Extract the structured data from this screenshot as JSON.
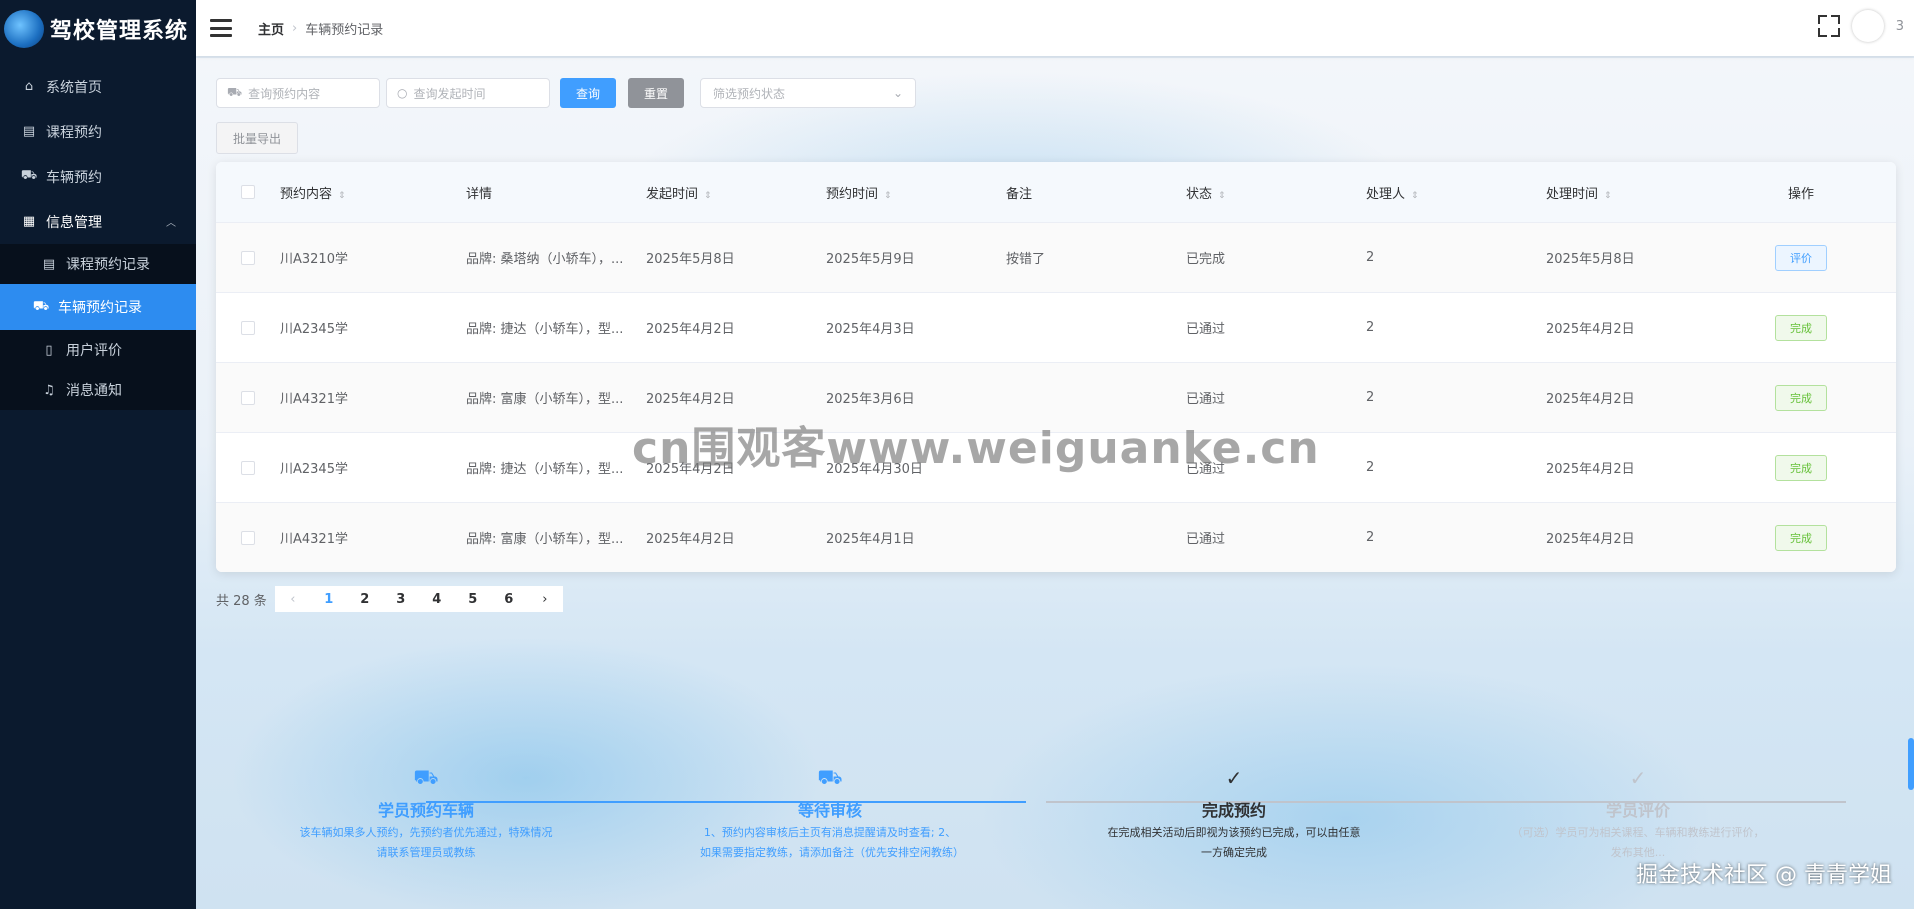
{
  "app": {
    "title": "驾校管理系统"
  },
  "sidebar": {
    "items": [
      {
        "label": "系统首页",
        "icon": "home-icon"
      },
      {
        "label": "课程预约",
        "icon": "course-icon"
      },
      {
        "label": "车辆预约",
        "icon": "truck-icon"
      },
      {
        "label": "信息管理",
        "icon": "grid-icon",
        "expanded": true,
        "children": [
          {
            "label": "课程预约记录",
            "icon": "course-icon"
          },
          {
            "label": "车辆预约记录",
            "icon": "truck-icon",
            "active": true
          },
          {
            "label": "用户评价",
            "icon": "doc-icon"
          },
          {
            "label": "消息通知",
            "icon": "bell-icon"
          }
        ]
      }
    ]
  },
  "header": {
    "breadcrumb": {
      "home": "主页",
      "current": "车辆预约记录"
    },
    "avatar_badge": "3"
  },
  "search": {
    "content_placeholder": "查询预约内容",
    "time_placeholder": "查询发起时间",
    "query_label": "查询",
    "reset_label": "重置",
    "status_placeholder": "筛选预约状态",
    "export_label": "批量导出"
  },
  "table": {
    "columns": [
      "预约内容",
      "详情",
      "发起时间",
      "预约时间",
      "备注",
      "状态",
      "处理人",
      "处理时间",
      "操作"
    ],
    "rows": [
      {
        "content": "川A3210学",
        "detail": "品牌: 桑塔纳（小轿车），...",
        "created": "2025年5月8日",
        "reserved": "2025年5月9日",
        "note": "按错了",
        "status": "已完成",
        "handler": "2",
        "handled": "2025年5月8日",
        "action": "评价",
        "action_type": "blue"
      },
      {
        "content": "川A2345学",
        "detail": "品牌: 捷达（小轿车），型...",
        "created": "2025年4月2日",
        "reserved": "2025年4月3日",
        "note": "",
        "status": "已通过",
        "handler": "2",
        "handled": "2025年4月2日",
        "action": "完成",
        "action_type": "green"
      },
      {
        "content": "川A4321学",
        "detail": "品牌: 富康（小轿车），型...",
        "created": "2025年4月2日",
        "reserved": "2025年3月6日",
        "note": "",
        "status": "已通过",
        "handler": "2",
        "handled": "2025年4月2日",
        "action": "完成",
        "action_type": "green"
      },
      {
        "content": "川A2345学",
        "detail": "品牌: 捷达（小轿车），型...",
        "created": "2025年4月2日",
        "reserved": "2025年4月30日",
        "note": "",
        "status": "已通过",
        "handler": "2",
        "handled": "2025年4月2日",
        "action": "完成",
        "action_type": "green"
      },
      {
        "content": "川A4321学",
        "detail": "品牌: 富康（小轿车），型...",
        "created": "2025年4月2日",
        "reserved": "2025年4月1日",
        "note": "",
        "status": "已通过",
        "handler": "2",
        "handled": "2025年4月2日",
        "action": "完成",
        "action_type": "green"
      }
    ]
  },
  "pagination": {
    "total_label": "共 28 条",
    "pages": [
      "1",
      "2",
      "3",
      "4",
      "5",
      "6"
    ],
    "current": "1",
    "prev": "‹",
    "next": "›"
  },
  "watermark": "cn围观客www.weiguanke.cn",
  "steps": [
    {
      "title": "学员预约车辆",
      "desc": "该车辆如果多人预约，先预约者优先通过，特殊情况请联系管理员或教练",
      "state": "blue",
      "icon": "truck-icon"
    },
    {
      "title": "等待审核",
      "desc": "1、预约内容审核后主页有消息提醒请及时查看; 2、如果需要指定教练，请添加备注（优先安排空闲教练）",
      "state": "blue",
      "icon": "truck-icon"
    },
    {
      "title": "完成预约",
      "desc": "在完成相关活动后即视为该预约已完成，可以由任意一方确定完成",
      "state": "dark",
      "icon": "check-circle-icon"
    },
    {
      "title": "学员评价",
      "desc": "（可选）学员可为相关课程、车辆和教练进行评价，发布其他...",
      "state": "gray",
      "icon": "check-circle-icon"
    }
  ],
  "credit": "掘金技术社区 @ 青青学姐"
}
